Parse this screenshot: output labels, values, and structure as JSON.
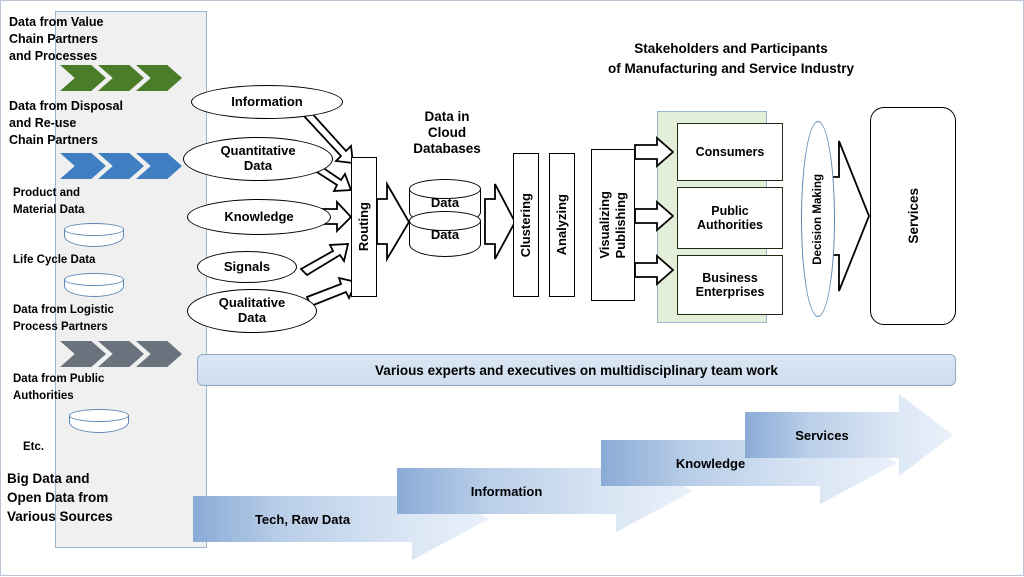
{
  "diagram": {
    "titles": {
      "stakeholders": "Stakeholders and Participants\nof Manufacturing and Service Industry",
      "stakeholders_line1": "Stakeholders and Participants",
      "stakeholders_line2": "of Manufacturing and Service Industry",
      "cloud_databases": "Data in Cloud Databases",
      "cloud_line1": "Data in",
      "cloud_line2": "Cloud",
      "cloud_line3": "Databases"
    },
    "sidebar": {
      "items": [
        {
          "label": "Data from Value\nChain Partners\nand Processes",
          "icon": "chevron-arrows-green"
        },
        {
          "label": "Data from Disposal\nand Re-use\nChain Partners",
          "icon": "chevron-arrows-blue"
        },
        {
          "label": "Product and\nMaterial Data",
          "icon": "database-cylinder-icon"
        },
        {
          "label": "Life Cycle Data",
          "icon": "database-cylinder-icon"
        },
        {
          "label": "Data from Logistic\nProcess Partners",
          "icon": "chevron-arrows-gray"
        },
        {
          "label": "Data from Public\nAuthorities",
          "icon": "database-cylinder-icon"
        },
        {
          "label": "Etc.",
          "icon": "none"
        }
      ],
      "footer": "Big Data and\nOpen Data from\nVarious Sources",
      "texts": {
        "t1": "Data from Value",
        "t1b": "Chain Partners",
        "t1c": "and Processes",
        "t2": "Data from Disposal",
        "t2b": "and Re-use",
        "t2c": "Chain Partners",
        "t3": "Product and",
        "t3b": "Material Data",
        "t4": "Life Cycle Data",
        "t5": "Data from Logistic",
        "t5b": "Process Partners",
        "t6": "Data from Public",
        "t6b": "Authorities",
        "t7": "Etc.",
        "t8": "Big Data and",
        "t8b": "Open Data from",
        "t8c": "Various Sources"
      }
    },
    "sources": [
      {
        "label": "Information"
      },
      {
        "label": "Quantitative Data",
        "line1": "Quantitative",
        "line2": "Data"
      },
      {
        "label": "Knowledge"
      },
      {
        "label": "Signals"
      },
      {
        "label": "Qualitative Data",
        "line1": "Qualitative",
        "line2": "Data"
      }
    ],
    "pipeline": [
      {
        "label": "Routing"
      },
      {
        "label": "Clustering"
      },
      {
        "label": "Analyzing"
      },
      {
        "label": "Visualizing Publishing",
        "line1": "Visualizing",
        "line2": "Publishing"
      }
    ],
    "databases": [
      {
        "label": "Data"
      },
      {
        "label": "Data"
      }
    ],
    "stakeholders": [
      {
        "label": "Consumers"
      },
      {
        "label": "Public Authorities",
        "line1": "Public",
        "line2": "Authorities"
      },
      {
        "label": "Business Enterprises",
        "line1": "Business",
        "line2": "Enterprises"
      }
    ],
    "decision": {
      "label": "Decision Making"
    },
    "services": {
      "label": "Services"
    },
    "experts_banner": {
      "label": "Various experts and executives on multidisciplinary team work"
    },
    "value_chain": [
      {
        "label": "Tech, Raw Data"
      },
      {
        "label": "Information"
      },
      {
        "label": "Knowledge"
      },
      {
        "label": "Services"
      }
    ],
    "colors": {
      "sidebar_bg": "#f0f0f0",
      "sidebar_border": "#9eb6cd",
      "chevron_green": "#4a7c29",
      "chevron_blue": "#3f7fc1",
      "chevron_gray": "#69727d",
      "cylinder_outline": "#5b87b5",
      "stakeholder_panel_bg": "#e3efd9",
      "stakeholder_panel_border": "#9ab4cf",
      "banner_bg": "#dce7f4",
      "banner_border": "#8fa9c4",
      "arrow_dark": "#7ba1cf",
      "arrow_light": "#dbe6f4",
      "outline": "#000000"
    }
  }
}
